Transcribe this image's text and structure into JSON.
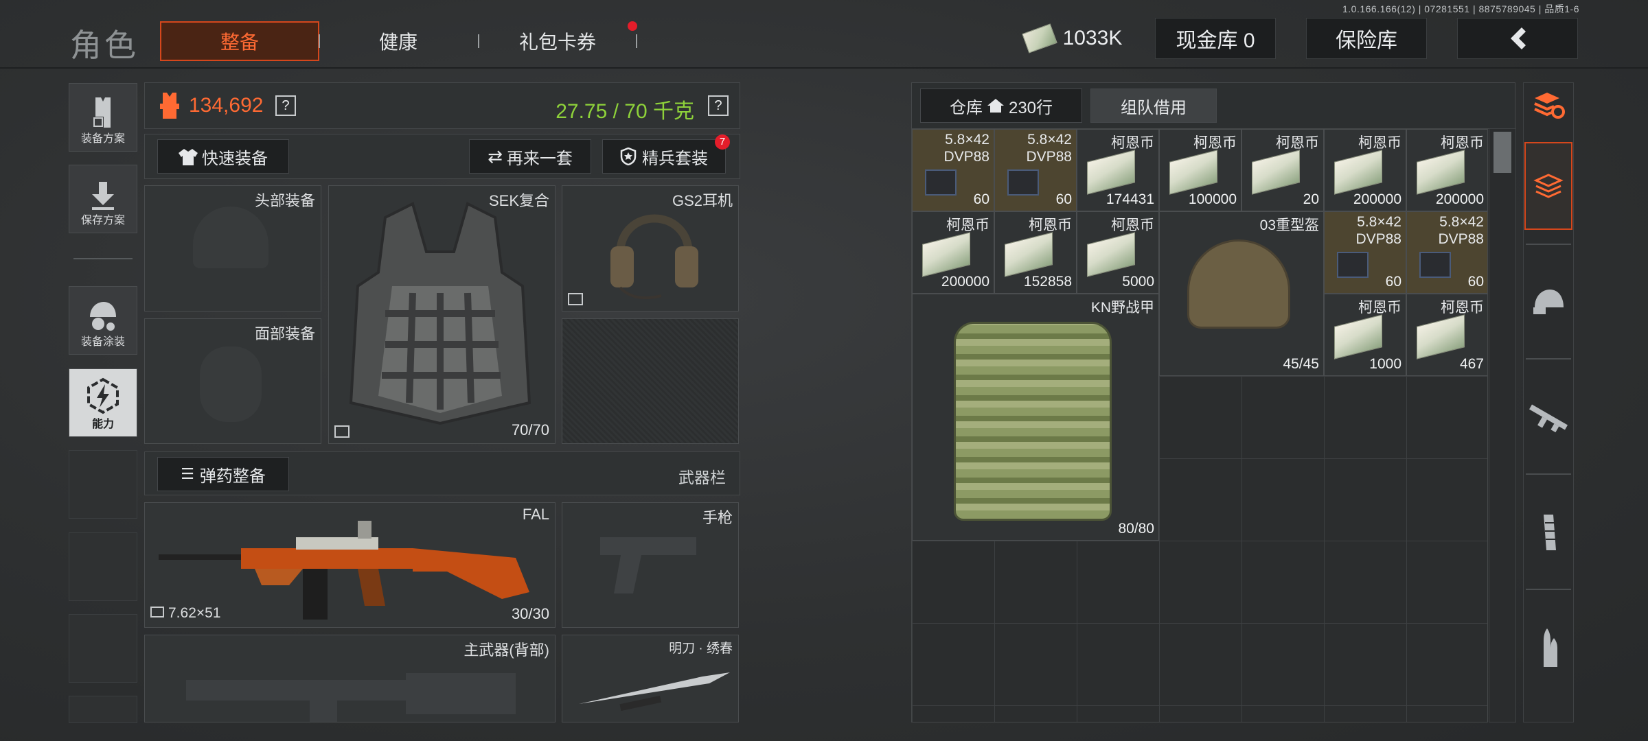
{
  "version": "1.0.166.166(12) | 07281551 | 8875789045 | 品质1-6",
  "title": "角色",
  "tabs": [
    {
      "label": "整备",
      "active": true
    },
    {
      "label": "健康"
    },
    {
      "label": "礼包卡券",
      "badge_dot": true
    }
  ],
  "currency": {
    "money": "1033K",
    "cash_vault": "现金库 0",
    "insured": "保险库",
    "back_icon": "chevron-left-icon"
  },
  "left_menu": [
    {
      "label": "装备方案",
      "icon": "vest-plan-icon"
    },
    {
      "label": "保存方案",
      "icon": "download-icon"
    },
    {
      "label": "装备涂装",
      "icon": "helmet-skin-icon"
    },
    {
      "label": "能力",
      "icon": "ability-icon",
      "active": true
    }
  ],
  "stats": {
    "value": "134,692",
    "weight": "27.75 / 70 千克",
    "help": "?"
  },
  "actions": {
    "quick_equip": "快速装备",
    "again": "再来一套",
    "elite": "精兵套装",
    "elite_badge": "7"
  },
  "slots": {
    "head": "头部装备",
    "face": "面部装备",
    "armor": {
      "name": "SEK复合",
      "count": "70/70"
    },
    "headset": {
      "name": "GS2耳机"
    }
  },
  "ammo_bar": {
    "label": "弹药整备",
    "weapons": "武器栏"
  },
  "weapons": {
    "primary": {
      "name": "FAL",
      "caliber": "7.62×51",
      "count": "30/30"
    },
    "pistol": "手枪",
    "back": "主武器(背部)",
    "melee": "明刀 · 绣春"
  },
  "warehouse": {
    "tab1": "仓库",
    "tab1_rows": "230行",
    "tab2": "组队借用"
  },
  "inventory": [
    {
      "type": "ammo",
      "name": "5.8×42",
      "sub": "DVP88",
      "count": "60"
    },
    {
      "type": "ammo",
      "name": "5.8×42",
      "sub": "DVP88",
      "count": "60"
    },
    {
      "type": "cash",
      "name": "柯恩币",
      "count": "174431"
    },
    {
      "type": "cash",
      "name": "柯恩币",
      "count": "100000"
    },
    {
      "type": "cash",
      "name": "柯恩币",
      "count": "20"
    },
    {
      "type": "cash",
      "name": "柯恩币",
      "count": "200000"
    },
    {
      "type": "cash",
      "name": "柯恩币",
      "count": "200000"
    },
    {
      "type": "cash",
      "name": "柯恩币",
      "count": "200000"
    },
    {
      "type": "cash",
      "name": "柯恩币",
      "count": "152858"
    },
    {
      "type": "cash",
      "name": "柯恩币",
      "count": "5000"
    },
    {
      "type": "helmet",
      "name": "03重型盔",
      "count": "45/45"
    },
    {
      "type": "ammo",
      "name": "5.8×42",
      "sub": "DVP88",
      "count": "60"
    },
    {
      "type": "ammo",
      "name": "5.8×42",
      "sub": "DVP88",
      "count": "60"
    },
    {
      "type": "vest",
      "name": "KN野战甲",
      "count": "80/80"
    },
    {
      "type": "cash",
      "name": "柯恩币",
      "count": "1000"
    },
    {
      "type": "cash",
      "name": "柯恩币",
      "count": "467"
    }
  ],
  "right_tabs": [
    "sort-stack-icon",
    "inventory-tab-icon",
    "helmet-tab-icon",
    "rifle-tab-icon",
    "magazine-tab-icon",
    "bullet-tab-icon"
  ],
  "colors": {
    "accent": "#ff6a33",
    "weight_green": "#8ed23a",
    "ammo_cell": "#4d4530"
  }
}
